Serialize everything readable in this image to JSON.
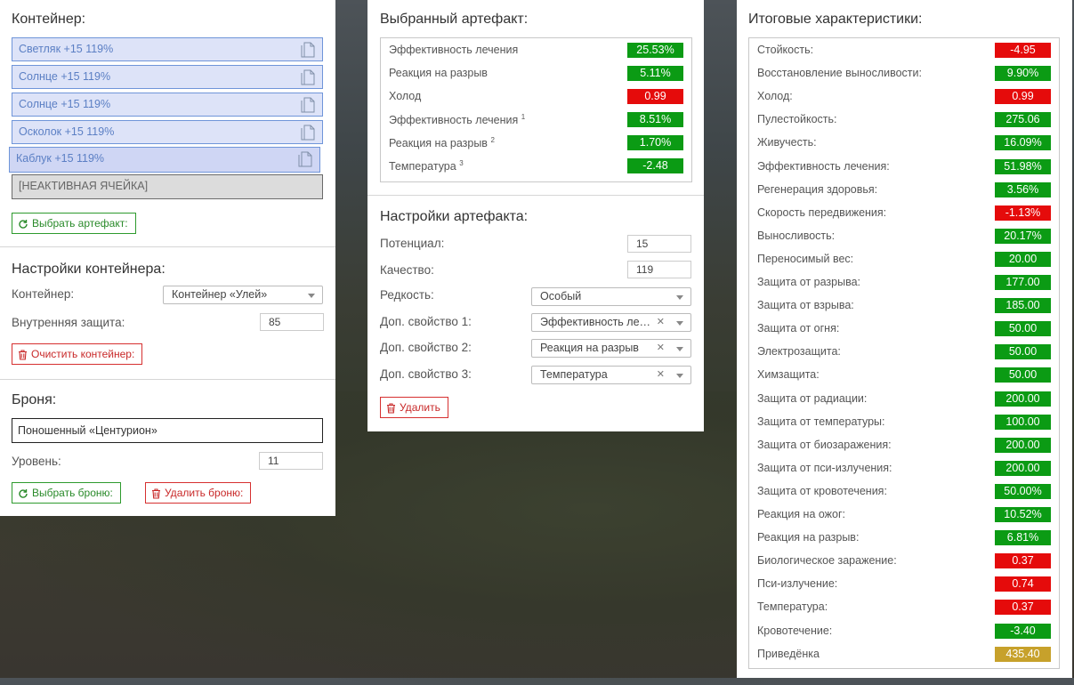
{
  "colors": {
    "positive": "#0b9b14",
    "negative": "#e50b0b",
    "neutral": "#c7a12b",
    "link_blue": "#5b7fc4"
  },
  "container": {
    "title": "Контейнер:",
    "slots": [
      {
        "label": "Светляк +15 119%",
        "icon": "document-icon"
      },
      {
        "label": "Солнце +15 119%",
        "icon": "document-icon"
      },
      {
        "label": "Солнце +15 119%",
        "icon": "document-icon"
      },
      {
        "label": "Осколок +15 119%",
        "icon": "document-icon"
      },
      {
        "label": "Каблук +15 119%",
        "icon": "document-icon"
      }
    ],
    "inactive_slot": "[НЕАКТИВНАЯ ЯЧЕЙКА]",
    "choose_artifact": "Выбрать артефакт:"
  },
  "container_settings": {
    "title": "Настройки контейнера:",
    "container_label": "Контейнер:",
    "container_value": "Контейнер «Улей»",
    "protection_label": "Внутренняя защита:",
    "protection_value": "85",
    "clear_button": "Очистить контейнер:"
  },
  "armor": {
    "title": "Броня:",
    "name": "Поношенный «Центурион»",
    "level_label": "Уровень:",
    "level_value": "11",
    "choose_button": "Выбрать броню:",
    "delete_button": "Удалить броню:"
  },
  "selected_artifact": {
    "title": "Выбранный артефакт:",
    "stats": [
      {
        "name": "Эффективность лечения",
        "sup": "",
        "value": "25.53%",
        "status": "positive"
      },
      {
        "name": "Реакция на разрыв",
        "sup": "",
        "value": "5.11%",
        "status": "positive"
      },
      {
        "name": "Холод",
        "sup": "",
        "value": "0.99",
        "status": "negative"
      },
      {
        "name": "Эффективность лечения",
        "sup": "1",
        "value": "8.51%",
        "status": "positive"
      },
      {
        "name": "Реакция на разрыв",
        "sup": "2",
        "value": "1.70%",
        "status": "positive"
      },
      {
        "name": "Температура",
        "sup": "3",
        "value": "-2.48",
        "status": "positive"
      }
    ]
  },
  "artifact_settings": {
    "title": "Настройки артефакта:",
    "potential_label": "Потенциал:",
    "potential_value": "15",
    "quality_label": "Качество:",
    "quality_value": "119",
    "rarity_label": "Редкость:",
    "rarity_value": "Особый",
    "extra1_label": "Доп. свойство 1:",
    "extra1_value": "Эффективность ле…",
    "extra2_label": "Доп. свойство 2:",
    "extra2_value": "Реакция на разрыв",
    "extra3_label": "Доп. свойство 3:",
    "extra3_value": "Температура",
    "delete_button": "Удалить"
  },
  "totals": {
    "title": "Итоговые характеристики:",
    "stats": [
      {
        "name": "Стойкость:",
        "value": "-4.95",
        "status": "negative"
      },
      {
        "name": "Восстановление выносливости:",
        "value": "9.90%",
        "status": "positive"
      },
      {
        "name": "Холод:",
        "value": "0.99",
        "status": "negative"
      },
      {
        "name": "Пулестойкость:",
        "value": "275.06",
        "status": "positive"
      },
      {
        "name": "Живучесть:",
        "value": "16.09%",
        "status": "positive"
      },
      {
        "name": "Эффективность лечения:",
        "value": "51.98%",
        "status": "positive"
      },
      {
        "name": "Регенерация здоровья:",
        "value": "3.56%",
        "status": "positive"
      },
      {
        "name": "Скорость передвижения:",
        "value": "-1.13%",
        "status": "negative"
      },
      {
        "name": "Выносливость:",
        "value": "20.17%",
        "status": "positive"
      },
      {
        "name": "Переносимый вес:",
        "value": "20.00",
        "status": "positive"
      },
      {
        "name": "Защита от разрыва:",
        "value": "177.00",
        "status": "positive"
      },
      {
        "name": "Защита от взрыва:",
        "value": "185.00",
        "status": "positive"
      },
      {
        "name": "Защита от огня:",
        "value": "50.00",
        "status": "positive"
      },
      {
        "name": "Электрозащита:",
        "value": "50.00",
        "status": "positive"
      },
      {
        "name": "Химзащита:",
        "value": "50.00",
        "status": "positive"
      },
      {
        "name": "Защита от радиации:",
        "value": "200.00",
        "status": "positive"
      },
      {
        "name": "Защита от температуры:",
        "value": "100.00",
        "status": "positive"
      },
      {
        "name": "Защита от биозаражения:",
        "value": "200.00",
        "status": "positive"
      },
      {
        "name": "Защита от пси-излучения:",
        "value": "200.00",
        "status": "positive"
      },
      {
        "name": "Защита от кровотечения:",
        "value": "50.00%",
        "status": "positive"
      },
      {
        "name": "Реакция на ожог:",
        "value": "10.52%",
        "status": "positive"
      },
      {
        "name": "Реакция на разрыв:",
        "value": "6.81%",
        "status": "positive"
      },
      {
        "name": "Биологическое заражение:",
        "value": "0.37",
        "status": "negative"
      },
      {
        "name": "Пси-излучение:",
        "value": "0.74",
        "status": "negative"
      },
      {
        "name": "Температура:",
        "value": "0.37",
        "status": "negative"
      },
      {
        "name": "Кровотечение:",
        "value": "-3.40",
        "status": "positive"
      },
      {
        "name": "Приведёнка",
        "value": "435.40",
        "status": "neutral"
      }
    ]
  }
}
